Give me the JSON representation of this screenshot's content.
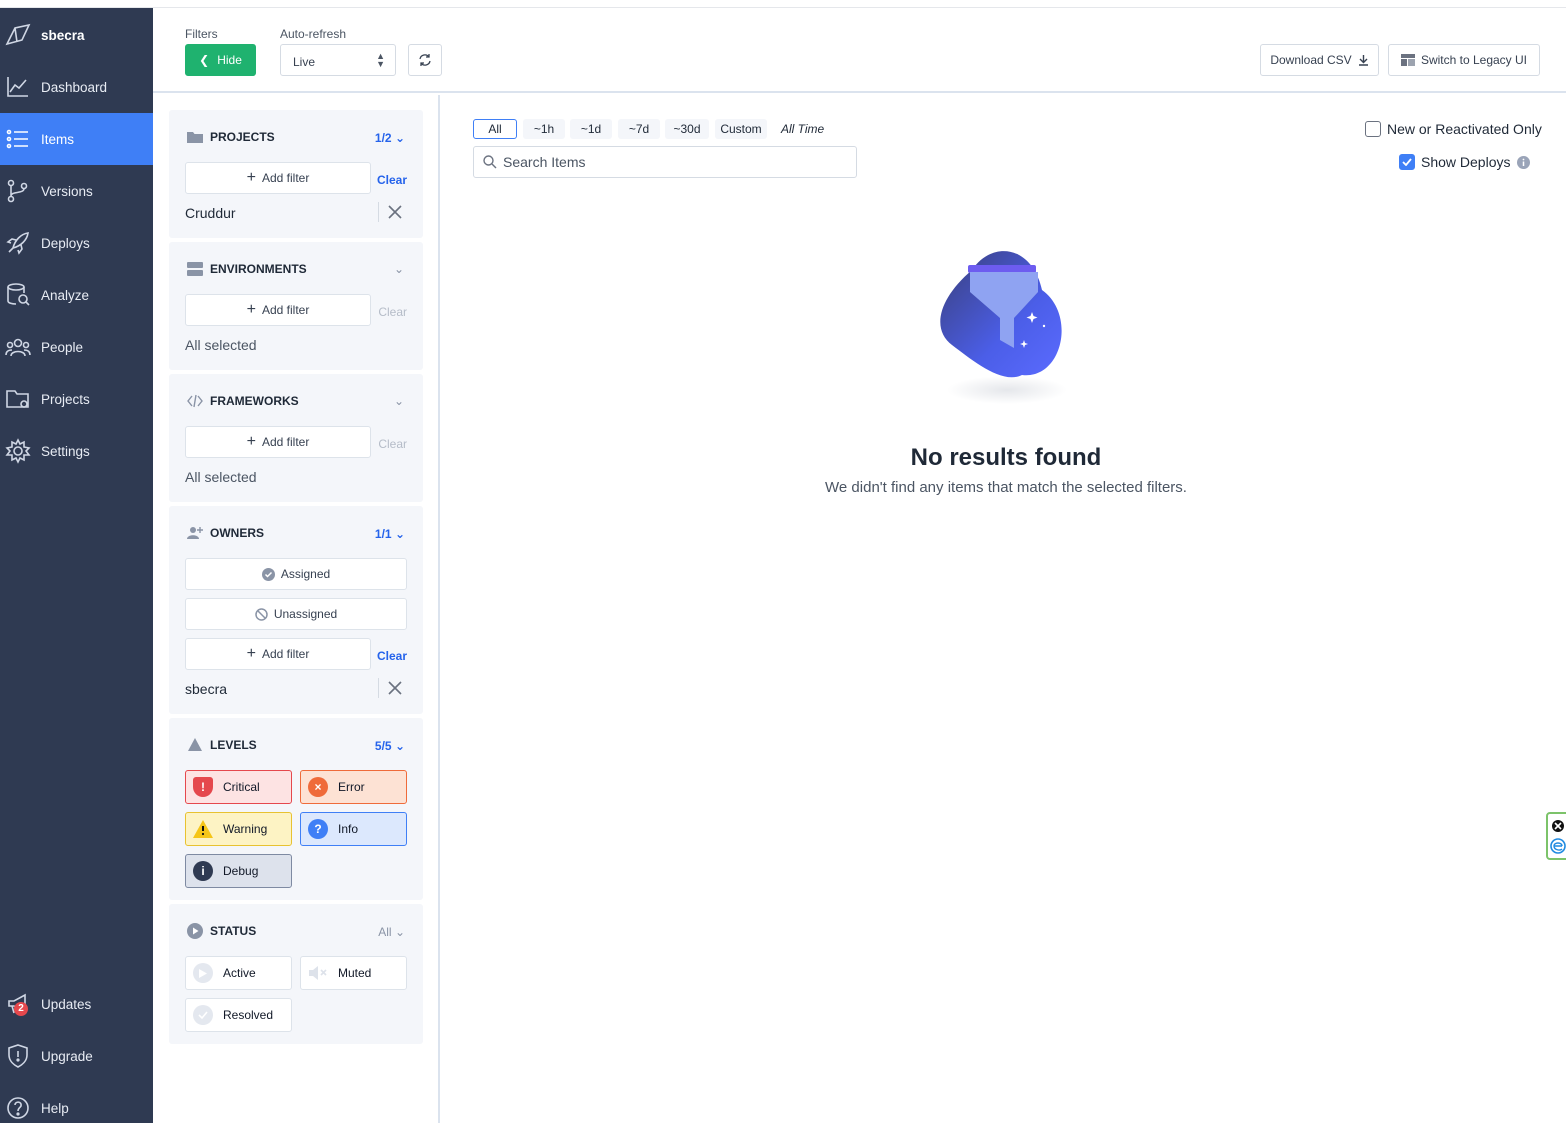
{
  "brand": {
    "name": "sbecra"
  },
  "sidebar": {
    "items": [
      {
        "label": "Dashboard"
      },
      {
        "label": "Items"
      },
      {
        "label": "Versions"
      },
      {
        "label": "Deploys"
      },
      {
        "label": "Analyze"
      },
      {
        "label": "People"
      },
      {
        "label": "Projects"
      },
      {
        "label": "Settings"
      }
    ],
    "bottom": [
      {
        "label": "Updates",
        "badge": "2"
      },
      {
        "label": "Upgrade"
      },
      {
        "label": "Help"
      }
    ]
  },
  "header": {
    "filters_label": "Filters",
    "hide_button": "Hide",
    "autorefresh_label": "Auto-refresh",
    "autorefresh_value": "Live",
    "download_csv": "Download CSV",
    "switch_legacy": "Switch to Legacy UI"
  },
  "filters": {
    "projects": {
      "title": "PROJECTS",
      "count": "1/2",
      "add": "Add filter",
      "clear": "Clear",
      "selected": "Cruddur"
    },
    "environments": {
      "title": "ENVIRONMENTS",
      "add": "Add filter",
      "clear": "Clear",
      "selected": "All selected"
    },
    "frameworks": {
      "title": "FRAMEWORKS",
      "add": "Add filter",
      "clear": "Clear",
      "selected": "All selected"
    },
    "owners": {
      "title": "OWNERS",
      "count": "1/1",
      "assigned": "Assigned",
      "unassigned": "Unassigned",
      "add": "Add filter",
      "clear": "Clear",
      "selected": "sbecra"
    },
    "levels": {
      "title": "LEVELS",
      "count": "5/5",
      "critical": "Critical",
      "error": "Error",
      "warning": "Warning",
      "info": "Info",
      "debug": "Debug"
    },
    "status": {
      "title": "STATUS",
      "count": "All",
      "active": "Active",
      "muted": "Muted",
      "resolved": "Resolved"
    }
  },
  "main": {
    "time_tabs": [
      "All",
      "~1h",
      "~1d",
      "~7d",
      "~30d",
      "Custom"
    ],
    "time_range": "All Time",
    "search_placeholder": "Search Items",
    "new_reactivated": "New or Reactivated Only",
    "show_deploys": "Show Deploys",
    "empty_title": "No results found",
    "empty_subtitle": "We didn't find any items that match the selected filters."
  },
  "colors": {
    "sidebar": "#2f3a52",
    "active": "#3f7ff6",
    "green": "#1fb26f",
    "link": "#2563eb"
  }
}
